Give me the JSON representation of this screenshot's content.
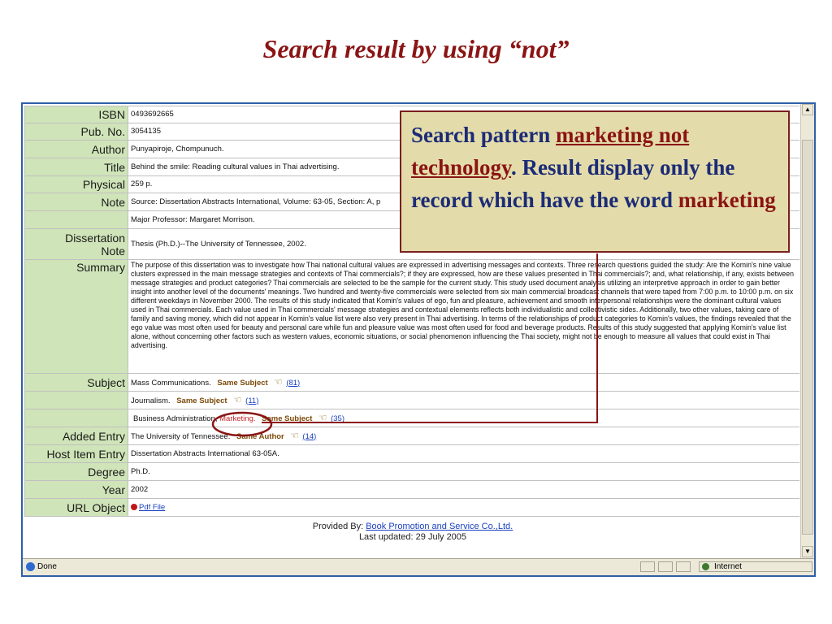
{
  "slide_title": "Search result by using “not”",
  "record": {
    "rows": [
      {
        "label": "ISBN",
        "value": "0493692665"
      },
      {
        "label": "Pub. No.",
        "value": "3054135"
      },
      {
        "label": "Author",
        "value": "Punyapiroje, Chompunuch."
      },
      {
        "label": "Title",
        "value": "Behind the smile: Reading cultural values in Thai advertising."
      },
      {
        "label": "Physical",
        "value": "259 p."
      },
      {
        "label": "Note",
        "value": "Source: Dissertation Abstracts International, Volume: 63-05, Section: A, p"
      },
      {
        "label": "",
        "value": "Major Professor: Margaret Morrison."
      }
    ],
    "dissertation_note": {
      "label_line1": "Dissertation",
      "label_line2": "Note",
      "value": "Thesis (Ph.D.)--The University of Tennessee, 2002."
    },
    "summary": {
      "label": "Summary",
      "value": "The purpose of this dissertation was to investigate how Thai national cultural values are expressed in advertising messages and contexts. Three research questions guided the study: Are the Komin's nine value clusters expressed in the main message strategies and contexts of Thai commercials?; if they are expressed, how are these values presented in Thai commercials?; and, what relationship, if any, exists between message strategies and product categories? Thai commercials are selected to be the sample for the current study. This study used document analysis utilizing an interpretive approach in order to gain better insight into another level of the documents' meanings. Two hundred and twenty-five commercials were selected from six main commercial broadcast channels that were taped from 7:00 p.m. to 10:00 p.m. on six different weekdays in November 2000. The results of this study indicated that Komin's values of ego, fun and pleasure, achievement and smooth interpersonal relationships were the dominant cultural values used in Thai commercials. Each value used in Thai commercials' message strategies and contextual elements reflects both individualistic and collectivistic sides. Additionally, two other values, taking care of family and saving money, which did not appear in Komin's value list were also very present in Thai advertising. In terms of the relationships of product categories to Komin's values, the findings revealed that the ego value was most often used for beauty and personal care while fun and pleasure value was most often used for food and beverage products. Results of this study suggested that applying Komin's value list alone, without concerning other factors such as western values, economic situations, or social phenomenon influencing the Thai society, might not be enough to measure all values that could exist in Thai advertising."
    },
    "subjects": {
      "label": "Subject",
      "items": [
        {
          "text": "Mass Communications.",
          "highlight": "",
          "link_label": "Same Subject",
          "count": "(81)"
        },
        {
          "text": "Journalism.",
          "highlight": "",
          "link_label": "Same Subject",
          "count": "(11)"
        },
        {
          "text": "Business Administration, ",
          "highlight": "Marketing.",
          "link_label": "Same Subject",
          "count": "(35)"
        }
      ]
    },
    "added_entry": {
      "label": "Added Entry",
      "value": "The University of Tennessee.",
      "link_label": "Same Author",
      "count": "(14)"
    },
    "host_item": {
      "label": "Host Item Entry",
      "value": "Dissertation Abstracts International 63-05A."
    },
    "degree": {
      "label": "Degree",
      "value": "Ph.D."
    },
    "year": {
      "label": "Year",
      "value": "2002"
    },
    "url_object": {
      "label": "URL Object",
      "link": "Pdf File"
    }
  },
  "footer": {
    "provided_by_label": "Provided By:",
    "provider_link": "Book Promotion and Service Co.,Ltd.",
    "last_updated": "Last updated: 29 July 2005"
  },
  "statusbar": {
    "text": "Done",
    "zone": "Internet"
  },
  "callout": {
    "part1": "Search pattern ",
    "pattern": "marketing not technology",
    "part2": ". Result display only the record which have the word ",
    "keyword": "marketing"
  },
  "colors": {
    "label_bg": "#cfe4b8",
    "accent": "#8b1414",
    "callout_text": "#1c2b76",
    "callout_bg": "#e3dcaa"
  },
  "icons": {
    "subject_link": "pointing-hand-icon",
    "pdf": "red-dot-icon"
  }
}
